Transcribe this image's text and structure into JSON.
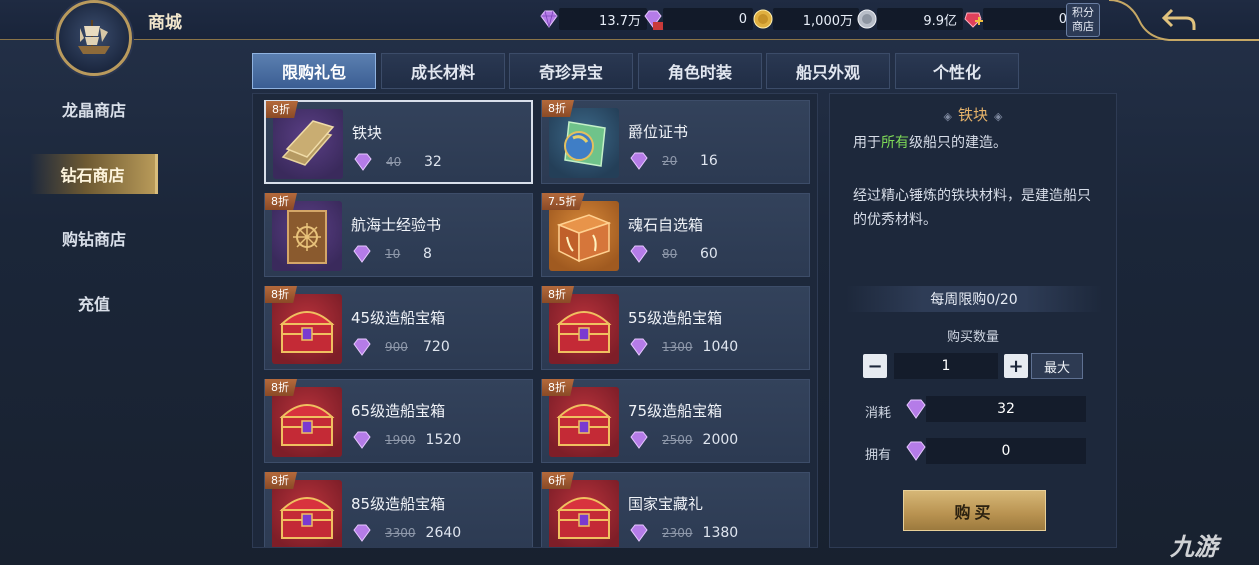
{
  "header": {
    "title": "商城",
    "points_shop": [
      "积分",
      "商店"
    ],
    "currencies": [
      {
        "icon": "diamond-icon",
        "value": "13.7万"
      },
      {
        "icon": "bound-diamond-icon",
        "value": "0"
      },
      {
        "icon": "gold-coin-icon",
        "value": "1,000万"
      },
      {
        "icon": "silver-coin-icon",
        "value": "9.9亿"
      },
      {
        "icon": "ruby-icon",
        "value": "0"
      }
    ]
  },
  "sidebar": {
    "items": [
      {
        "label": "龙晶商店"
      },
      {
        "label": "钻石商店"
      },
      {
        "label": "购钻商店"
      },
      {
        "label": "充值"
      }
    ],
    "active_index": 1
  },
  "tabs": [
    {
      "label": "限购礼包"
    },
    {
      "label": "成长材料"
    },
    {
      "label": "奇珍异宝"
    },
    {
      "label": "角色时装"
    },
    {
      "label": "船只外观"
    },
    {
      "label": "个性化"
    }
  ],
  "active_tab": 0,
  "items": [
    {
      "name": "铁块",
      "discount": "8折",
      "old_price": "40",
      "price": "32",
      "thumb": "iron-ingot-icon"
    },
    {
      "name": "爵位证书",
      "discount": "8折",
      "old_price": "20",
      "price": "16",
      "thumb": "certificate-icon"
    },
    {
      "name": "航海士经验书",
      "discount": "8折",
      "old_price": "10",
      "price": "8",
      "thumb": "book-icon"
    },
    {
      "name": "魂石自选箱",
      "discount": "7.5折",
      "old_price": "80",
      "price": "60",
      "thumb": "soulstone-box-icon"
    },
    {
      "name": "45级造船宝箱",
      "discount": "8折",
      "old_price": "900",
      "price": "720",
      "thumb": "treasure-chest-icon"
    },
    {
      "name": "55级造船宝箱",
      "discount": "8折",
      "old_price": "1300",
      "price": "1040",
      "thumb": "treasure-chest-icon"
    },
    {
      "name": "65级造船宝箱",
      "discount": "8折",
      "old_price": "1900",
      "price": "1520",
      "thumb": "treasure-chest-icon"
    },
    {
      "name": "75级造船宝箱",
      "discount": "8折",
      "old_price": "2500",
      "price": "2000",
      "thumb": "treasure-chest-icon"
    },
    {
      "name": "85级造船宝箱",
      "discount": "8折",
      "old_price": "3300",
      "price": "2640",
      "thumb": "treasure-chest-icon"
    },
    {
      "name": "国家宝藏礼",
      "discount": "6折",
      "old_price": "2300",
      "price": "1380",
      "thumb": "treasure-chest-icon"
    }
  ],
  "detail": {
    "title": "铁块",
    "desc_prefix": "用于",
    "desc_highlight": "所有",
    "desc_suffix": "级船只的建造。",
    "desc_long": "经过精心锤炼的铁块材料，是建造船只的优秀材料。",
    "weekly_limit": "每周限购0/20",
    "quantity_label": "购买数量",
    "quantity": "1",
    "max_label": "最大",
    "cost_label": "消耗",
    "cost_value": "32",
    "own_label": "拥有",
    "own_value": "0",
    "buy_label": "购买"
  },
  "watermark": "九游",
  "colors": {
    "accent_gold": "#b99a5d",
    "tab_active": "#4a6fa3",
    "discount": "#a35a30",
    "highlight_green": "#7ed957"
  }
}
